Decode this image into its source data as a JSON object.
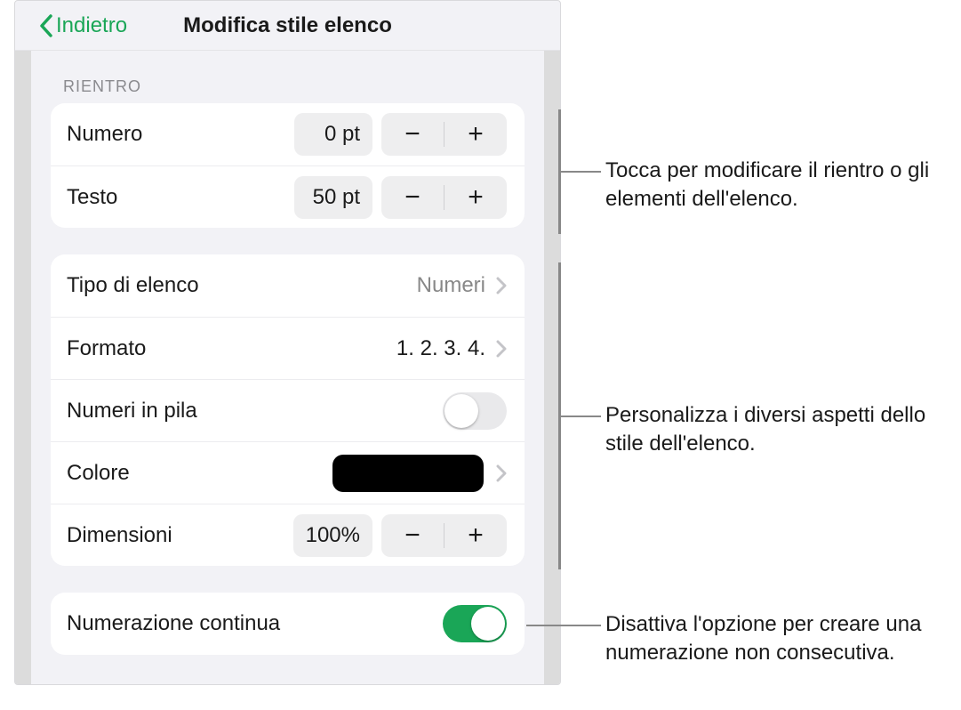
{
  "header": {
    "back_label": "Indietro",
    "title": "Modifica stile elenco"
  },
  "sections": {
    "indent_header": "RIENTRO"
  },
  "indent": {
    "number_label": "Numero",
    "number_value": "0 pt",
    "text_label": "Testo",
    "text_value": "50 pt"
  },
  "style": {
    "list_type_label": "Tipo di elenco",
    "list_type_value": "Numeri",
    "format_label": "Formato",
    "format_value": "1. 2. 3. 4.",
    "tiered_label": "Numeri in pila",
    "tiered_on": false,
    "color_label": "Colore",
    "color_value_hex": "#000000",
    "size_label": "Dimensioni",
    "size_value": "100%"
  },
  "continue": {
    "label": "Numerazione continua",
    "on": true
  },
  "callouts": {
    "c1": "Tocca per modificare il rientro o gli elementi dell'elenco.",
    "c2": "Personalizza i diversi aspetti dello stile dell'elenco.",
    "c3": "Disattiva l'opzione per creare una numerazione non consecutiva."
  }
}
